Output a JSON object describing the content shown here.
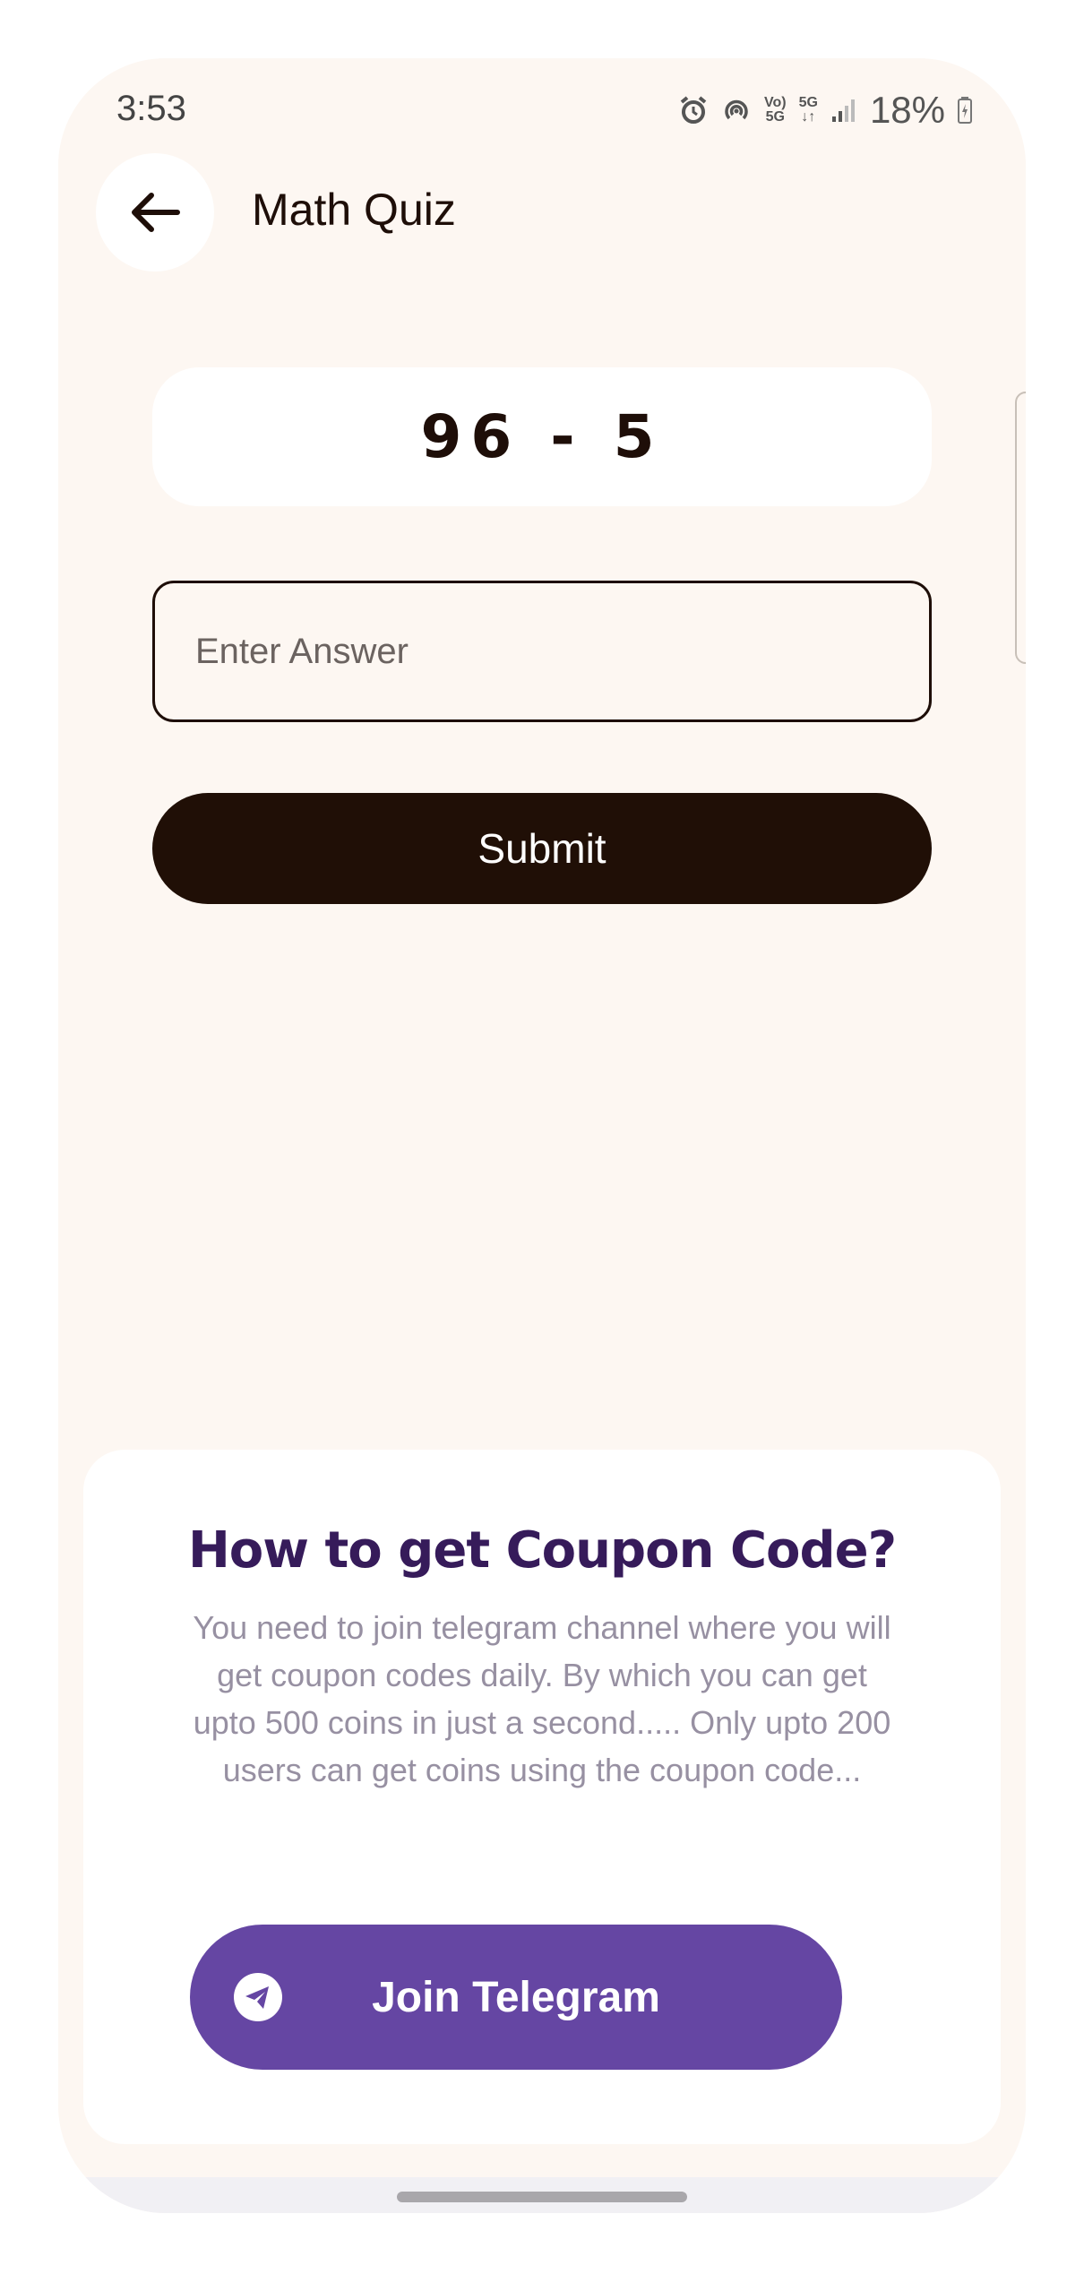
{
  "status_bar": {
    "time": "3:53",
    "network_volte": "Vo)",
    "network_5g_small": "5G",
    "network_5g": "5G",
    "battery": "18%"
  },
  "header": {
    "title": "Math Quiz",
    "back_icon": "arrow-left-icon"
  },
  "quiz": {
    "question": "96 - 5",
    "answer_placeholder": "Enter Answer",
    "answer_value": "",
    "submit_label": "Submit"
  },
  "coupon_card": {
    "heading": "How to get Coupon Code?",
    "body": "You need to join telegram channel where you will get coupon codes daily. By which you can get upto 500 coins in just a second..... Only upto 200 users can get coins using the coupon code...",
    "button_label": "Join Telegram",
    "button_icon": "telegram-icon"
  },
  "colors": {
    "background": "#fdf7f2",
    "primary_dark": "#200f06",
    "accent_purple": "#6546a3",
    "heading_purple": "#361b5a",
    "body_gray": "#9790a2"
  }
}
